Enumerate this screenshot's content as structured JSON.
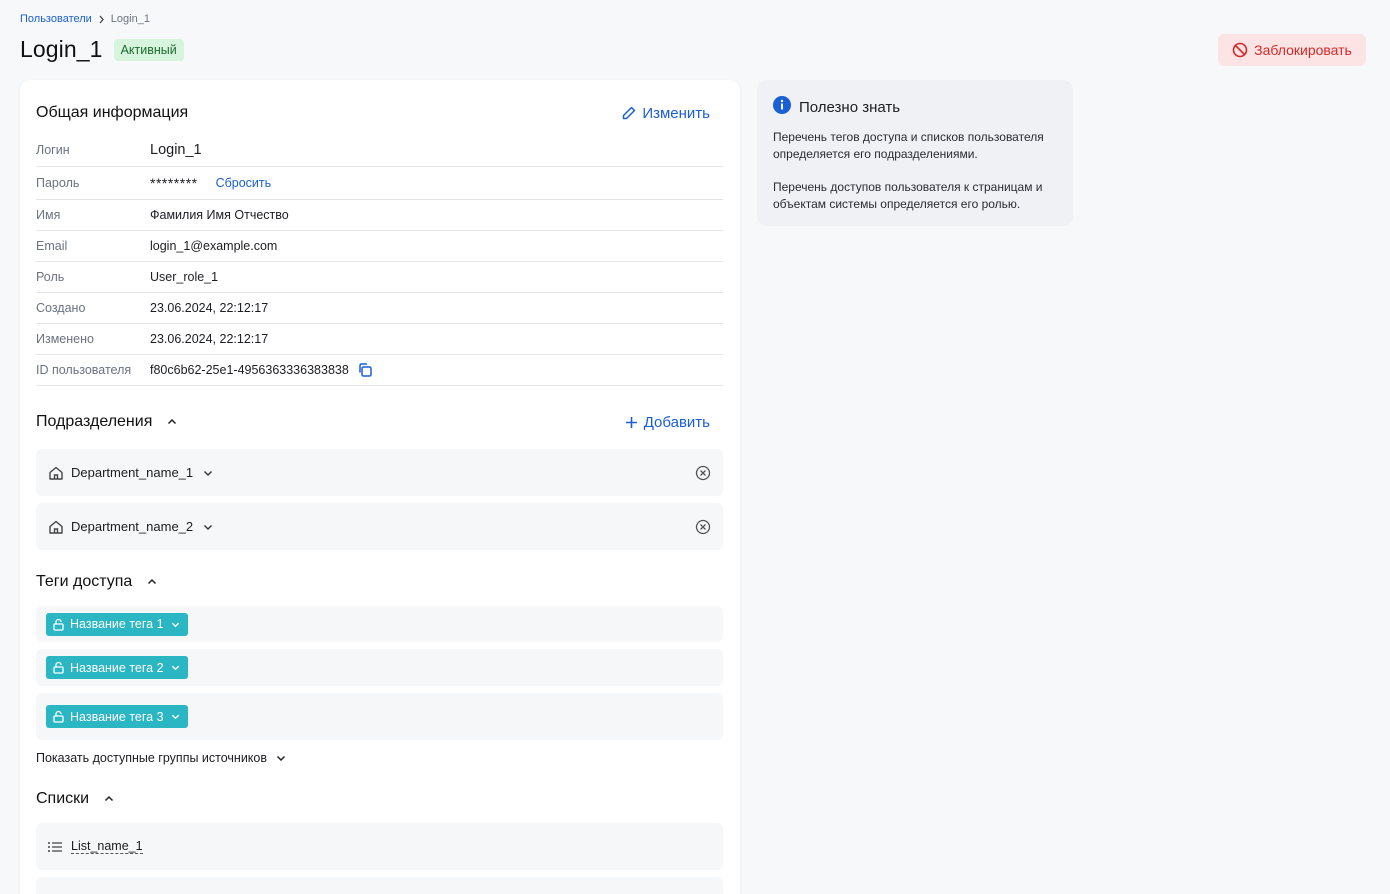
{
  "breadcrumb": {
    "parent": "Пользователи",
    "current": "Login_1"
  },
  "header": {
    "title": "Login_1",
    "status": "Активный",
    "block_label": "Заблокировать"
  },
  "general": {
    "title": "Общая информация",
    "edit_label": "Изменить",
    "rows": [
      {
        "label": "Логин",
        "value": "Login_1"
      },
      {
        "label": "Пароль",
        "value": "********",
        "action": "Сбросить"
      },
      {
        "label": "Имя",
        "value": "Фамилия Имя Отчество"
      },
      {
        "label": "Email",
        "value": "login_1@example.com"
      },
      {
        "label": "Роль",
        "value": "User_role_1"
      },
      {
        "label": "Создано",
        "value": "23.06.2024, 22:12:17"
      },
      {
        "label": "Изменено",
        "value": "23.06.2024, 22:12:17"
      },
      {
        "label": "ID пользователя",
        "value": "f80c6b62-25e1-4956363336383838"
      }
    ]
  },
  "departments": {
    "title": "Подразделения",
    "add_label": "Добавить",
    "items": [
      {
        "name": "Department_name_1"
      },
      {
        "name": "Department_name_2"
      }
    ]
  },
  "tags": {
    "title": "Теги доступа",
    "items": [
      {
        "name": "Название тега 1"
      },
      {
        "name": "Название тега 2"
      },
      {
        "name": "Название тега 3"
      }
    ],
    "show_groups_label": "Показать доступные группы источников"
  },
  "lists": {
    "title": "Списки",
    "items": [
      {
        "name": "List_name_1"
      }
    ]
  },
  "info_panel": {
    "title": "Полезно знать",
    "paragraphs": [
      "Перечень тегов доступа и списков пользователя определяется его подразделениями.",
      "Перечень доступов пользователя к страницам и объектам системы определяется его ролью."
    ]
  },
  "colors": {
    "accent": "#1a5fd6",
    "danger": "#d72828",
    "tag": "#2bb6c4",
    "active_badge": "#d7f4dc"
  }
}
